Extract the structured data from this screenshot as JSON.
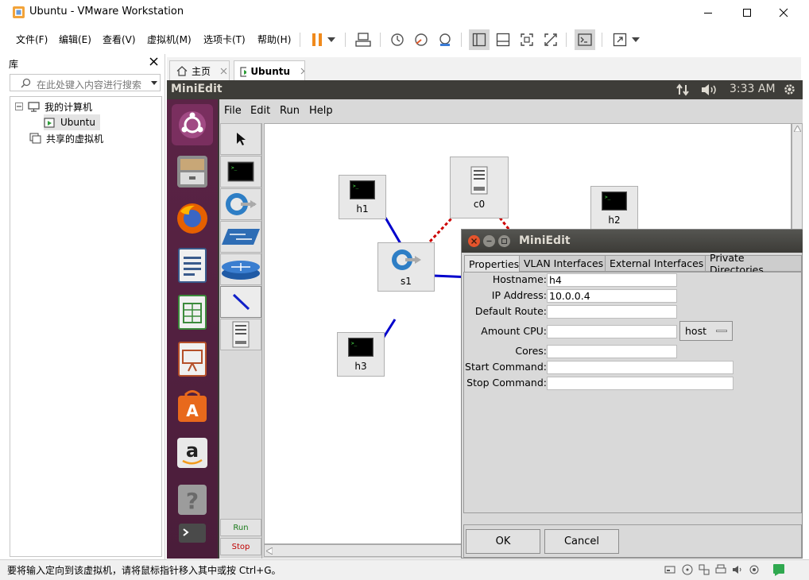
{
  "window": {
    "title": "Ubuntu - VMware Workstation"
  },
  "menubar": {
    "items": [
      "文件(F)",
      "编辑(E)",
      "查看(V)",
      "虚拟机(M)",
      "选项卡(T)",
      "帮助(H)"
    ]
  },
  "library": {
    "title": "库",
    "search_placeholder": "在此处键入内容进行搜索",
    "tree": {
      "my_computer": "我的计算机",
      "vm": "Ubuntu",
      "shared": "共享的虚拟机"
    }
  },
  "tabs": [
    {
      "label": "主页",
      "active": false
    },
    {
      "label": "Ubuntu",
      "active": true
    }
  ],
  "ubuntu": {
    "topbar": {
      "app_name": "MiniEdit",
      "clock": "3:33 AM"
    }
  },
  "miniedit": {
    "menu": [
      "File",
      "Edit",
      "Run",
      "Help"
    ],
    "tools": {
      "run_label": "Run",
      "stop_label": "Stop"
    },
    "nodes": {
      "h1": "h1",
      "h2": "h2",
      "h3": "h3",
      "s1": "s1",
      "c0": "c0"
    }
  },
  "dialog": {
    "title": "MiniEdit",
    "tabs": [
      "Properties",
      "VLAN Interfaces",
      "External Interfaces",
      "Private Directories"
    ],
    "fields": {
      "hostname_label": "Hostname:",
      "hostname_value": "h4",
      "ip_label": "IP Address:",
      "ip_value": "10.0.0.4",
      "route_label": "Default Route:",
      "route_value": "",
      "cpu_label": "Amount CPU:",
      "cpu_value": "",
      "cpu_mode": "host",
      "cores_label": "Cores:",
      "cores_value": "",
      "start_label": "Start Command:",
      "start_value": "",
      "stop_label": "Stop Command:",
      "stop_value": ""
    },
    "ok_label": "OK",
    "cancel_label": "Cancel"
  },
  "statusbar": {
    "message": "要将输入定向到该虚拟机，请将鼠标指针移入其中或按 Ctrl+G。"
  },
  "colors": {
    "ubuntu_panel": "#3e3d39",
    "launcher": "#5b2446",
    "dialog_close": "#e6542c",
    "link_blue": "#0000cc",
    "link_red": "#cc0000"
  }
}
